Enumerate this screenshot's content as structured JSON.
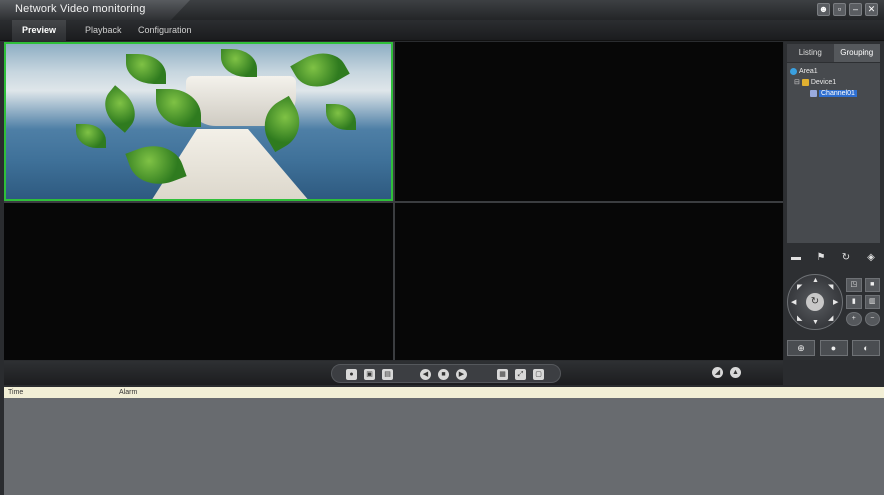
{
  "app": {
    "title": "Network Video monitoring"
  },
  "window_buttons": [
    "user-icon",
    "minimize-icon",
    "close-icon"
  ],
  "menu": {
    "items": [
      {
        "label": "Preview",
        "active": true
      },
      {
        "label": "Playback",
        "active": false
      },
      {
        "label": "Configuration",
        "active": false
      }
    ]
  },
  "right_panel": {
    "tabs": [
      {
        "label": "Listing",
        "active": false
      },
      {
        "label": "Grouping",
        "active": true
      }
    ],
    "tree": {
      "area": "Area1",
      "device": "Device1",
      "channel": "Channel01"
    }
  },
  "alarm_table": {
    "columns": [
      "Time",
      "Alarm"
    ]
  },
  "colors": {
    "selected_pane_border": "#2fbf3a",
    "selected_channel": "#2f6fd0",
    "alarm_header_bg": "#f2efd6"
  }
}
